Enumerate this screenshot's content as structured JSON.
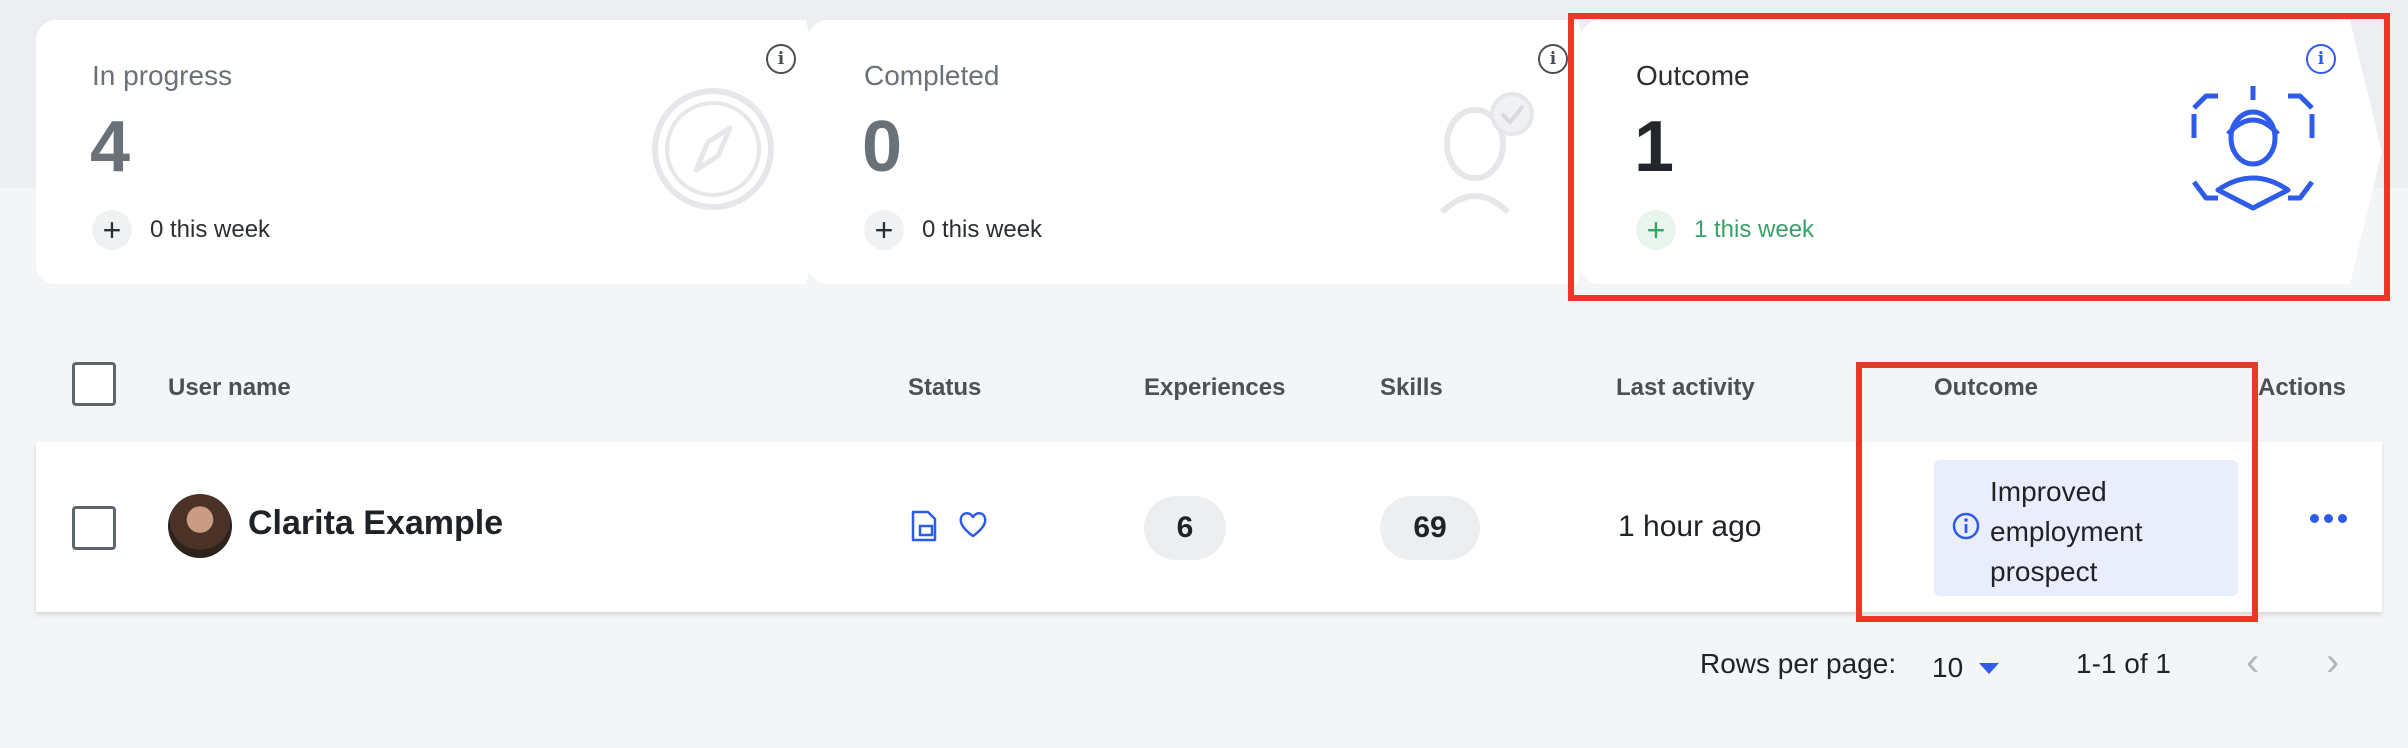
{
  "cards": [
    {
      "label": "In progress",
      "value": "4",
      "week": "0 this week",
      "icon": "compass-icon"
    },
    {
      "label": "Completed",
      "value": "0",
      "week": "0 this week",
      "icon": "user-check-icon"
    },
    {
      "label": "Outcome",
      "value": "1",
      "week": "1 this week",
      "icon": "user-focus-icon"
    }
  ],
  "table": {
    "headers": {
      "user_name": "User name",
      "status": "Status",
      "experiences": "Experiences",
      "skills": "Skills",
      "last_activity": "Last activity",
      "outcome": "Outcome",
      "actions": "Actions"
    },
    "rows": [
      {
        "user_name": "Clarita Example",
        "status_icons": [
          "document-icon",
          "heart-icon"
        ],
        "experiences": "6",
        "skills": "69",
        "last_activity": "1 hour ago",
        "outcome": "Improved employment prospect"
      }
    ]
  },
  "pagination": {
    "rows_per_page_label": "Rows per page:",
    "rows_per_page_value": "10",
    "range": "1-1 of 1"
  },
  "colors": {
    "accent": "#2f5bea",
    "positive": "#38a169",
    "highlight": "#e53a2a"
  }
}
